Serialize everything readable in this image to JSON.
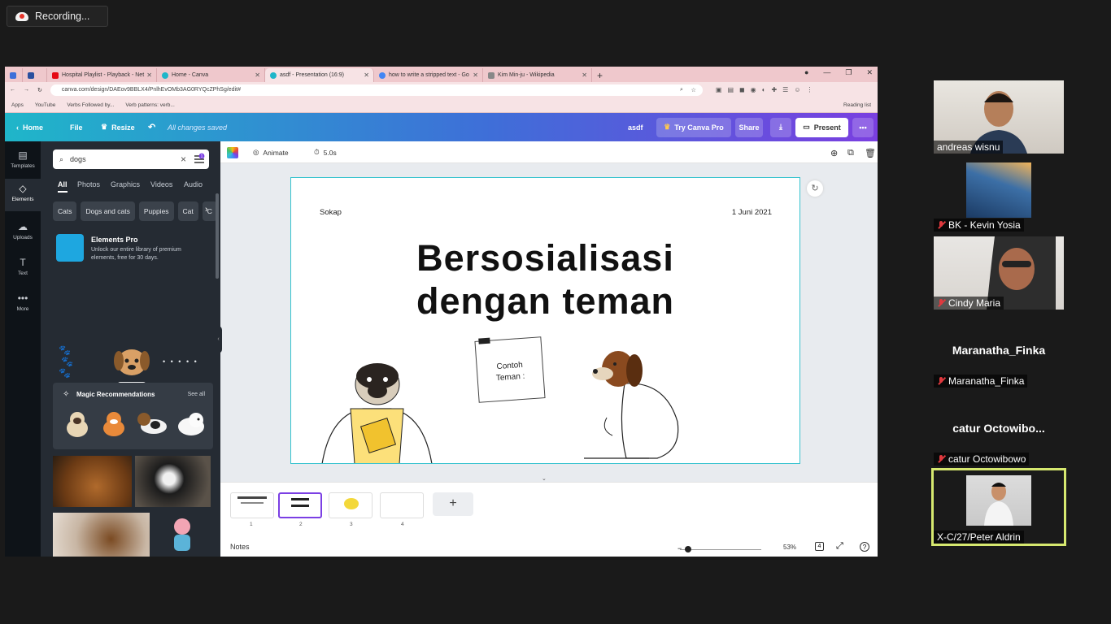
{
  "recording": {
    "label": "Recording..."
  },
  "browser": {
    "tabs": [
      {
        "title": "",
        "active": false
      },
      {
        "title": "Hospital Playlist - Playback - Net",
        "active": false
      },
      {
        "title": "Home - Canva",
        "active": false
      },
      {
        "title": "asdf - Presentation (16:9)",
        "active": true
      },
      {
        "title": "how to write a stripped text - Go",
        "active": false
      },
      {
        "title": "Kim Min-ju - Wikipedia",
        "active": false
      }
    ],
    "url": "canva.com/design/DAEov9BBLX4/PnlhEvOMb3AG0RYQcZPhSg/edit#",
    "bookmarks": [
      "Apps",
      "YouTube",
      "Verbs Followed by...",
      "Verb patterns: verb..."
    ],
    "reading_list": "Reading list"
  },
  "canva_header": {
    "home": "Home",
    "file": "File",
    "resize": "Resize",
    "saved": "All changes saved",
    "doc_name": "asdf",
    "try_pro": "Try Canva Pro",
    "share": "Share",
    "present": "Present"
  },
  "rail": [
    {
      "label": "Templates",
      "icon": "templates-icon"
    },
    {
      "label": "Elements",
      "icon": "elements-icon"
    },
    {
      "label": "Uploads",
      "icon": "uploads-icon"
    },
    {
      "label": "Text",
      "icon": "text-icon"
    },
    {
      "label": "More",
      "icon": "more-icon"
    }
  ],
  "panel": {
    "search_value": "dogs",
    "filter_badge": "1",
    "tabs": [
      "All",
      "Photos",
      "Graphics",
      "Videos",
      "Audio"
    ],
    "chips": [
      "Cats",
      "Dogs and cats",
      "Puppies",
      "Cat",
      "C"
    ],
    "elements_pro_title": "Elements Pro",
    "elements_pro_desc": "Unlock our entire library of premium elements, free for 30 days.",
    "magic_title": "Magic Recommendations",
    "see_all": "See all"
  },
  "toolbar": {
    "animate": "Animate",
    "duration": "5.0s"
  },
  "slide": {
    "left_text": "Sokap",
    "date": "1 Juni 2021",
    "title_line1": "Bersosialisasi",
    "title_line2": "dengan teman",
    "note_line1": "Contoh",
    "note_line2": "Teman :"
  },
  "pages": {
    "numbers": [
      "1",
      "2",
      "3",
      "4"
    ],
    "selected": 2
  },
  "bottom": {
    "notes": "Notes",
    "zoom": "53%",
    "page_count": "4"
  },
  "participants": [
    {
      "name": "andreas wisnu",
      "muted": false,
      "video": true
    },
    {
      "name": "BK - Kevin Yosia",
      "muted": true,
      "video": true
    },
    {
      "name": "Cindy Maria",
      "muted": true,
      "video": true
    },
    {
      "name": "Maranatha_Finka",
      "display": "Maranatha_Finka",
      "muted": true,
      "video": false
    },
    {
      "name": "catur Octowibowo",
      "display": "catur  Octowibo...",
      "muted": true,
      "video": false
    },
    {
      "name": "X-C/27/Peter Aldrin",
      "muted": false,
      "video": true,
      "active_speaker": true
    }
  ],
  "colors": {
    "accent": "#7b3fe4",
    "speaker_border": "#d6e86f",
    "canva_teal": "#1fb6c9"
  }
}
